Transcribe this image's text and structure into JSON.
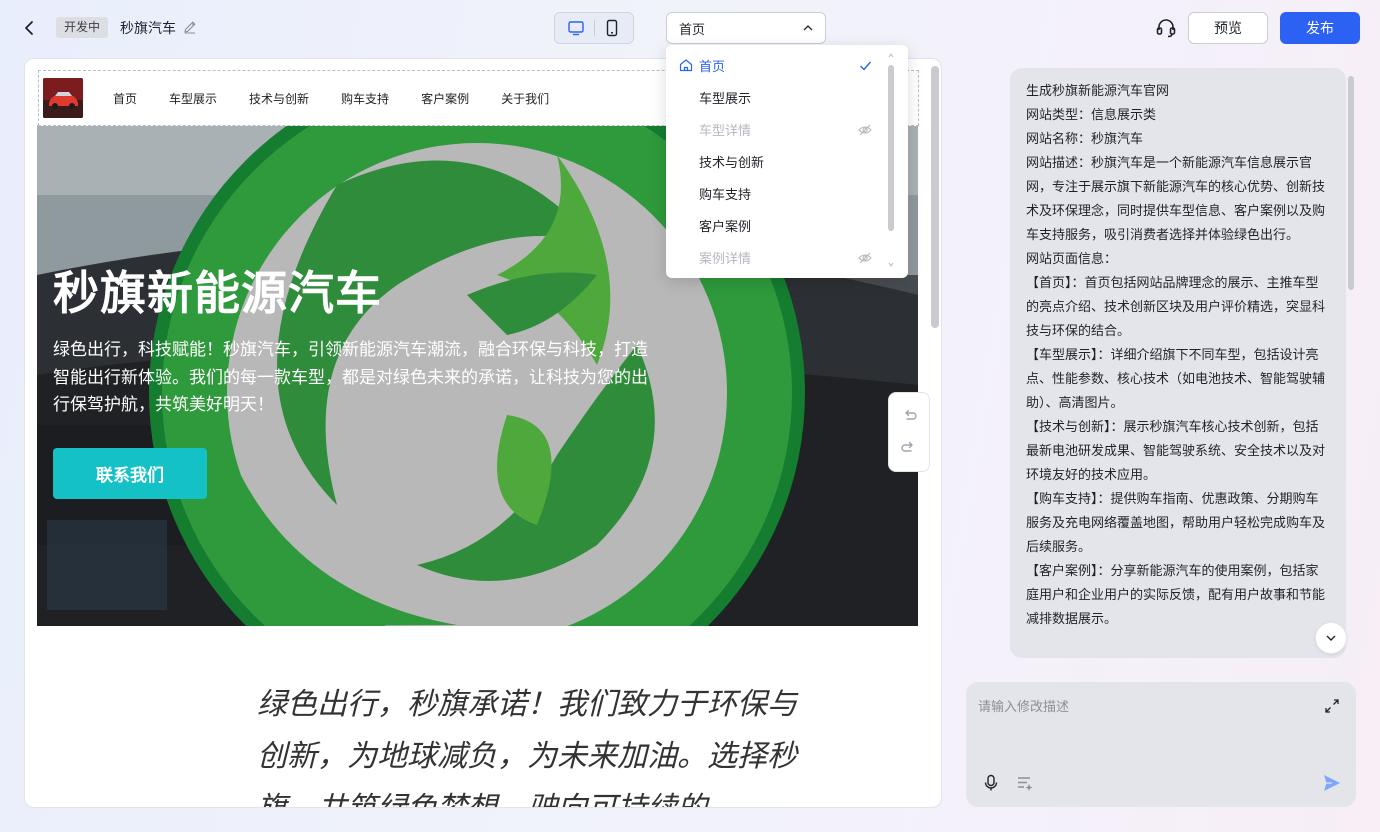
{
  "header": {
    "status_badge": "开发中",
    "site_name": "秒旗汽车",
    "page_select_value": "首页",
    "preview_label": "预览",
    "publish_label": "发布"
  },
  "site_nav": {
    "items": [
      "首页",
      "车型展示",
      "技术与创新",
      "购车支持",
      "客户案例",
      "关于我们"
    ]
  },
  "hero": {
    "title": "秒旗新能源汽车",
    "description": "绿色出行，科技赋能！秒旗汽车，引领新能源汽车潮流，融合环保与科技，打造智能出行新体验。我们的每一款车型，都是对绿色未来的承诺，让科技为您的出行保驾护航，共筑美好明天！",
    "cta_label": "联系我们"
  },
  "slogan": "绿色出行，秒旗承诺！我们致力于环保与创新，为地球减负，为未来加油。选择秒旗，共筑绿色梦想，驶向可持续的",
  "page_dropdown": {
    "items": [
      {
        "label": "首页",
        "state": "selected"
      },
      {
        "label": "车型展示",
        "state": "normal"
      },
      {
        "label": "车型详情",
        "state": "hidden"
      },
      {
        "label": "技术与创新",
        "state": "normal"
      },
      {
        "label": "购车支持",
        "state": "normal"
      },
      {
        "label": "客户案例",
        "state": "normal"
      },
      {
        "label": "案例详情",
        "state": "hidden"
      }
    ]
  },
  "chat": {
    "message": "生成秒旗新能源汽车官网\n网站类型：信息展示类\n网站名称：秒旗汽车\n网站描述：秒旗汽车是一个新能源汽车信息展示官网，专注于展示旗下新能源汽车的核心优势、创新技术及环保理念，同时提供车型信息、客户案例以及购车支持服务，吸引消费者选择并体验绿色出行。\n网站页面信息：\n【首页】：首页包括网站品牌理念的展示、主推车型的亮点介绍、技术创新区块及用户评价精选，突显科技与环保的结合。\n【车型展示】：详细介绍旗下不同车型，包括设计亮点、性能参数、核心技术（如电池技术、智能驾驶辅助）、高清图片。\n【技术与创新】：展示秒旗汽车核心技术创新，包括最新电池研发成果、智能驾驶系统、安全技术以及对环境友好的技术应用。\n【购车支持】：提供购车指南、优惠政策、分期购车服务及充电网络覆盖地图，帮助用户轻松完成购车及后续服务。\n【客户案例】：分享新能源汽车的使用案例，包括家庭用户和企业用户的实际反馈，配有用户故事和节能减排数据展示。",
    "input_placeholder": "请输入修改描述"
  },
  "colors": {
    "primary": "#2b62f3",
    "cta": "#14c2c5",
    "logo_green_dark": "#1a7e2f",
    "logo_green_light": "#5ba63b",
    "logo_gray": "#b9b9b9"
  }
}
